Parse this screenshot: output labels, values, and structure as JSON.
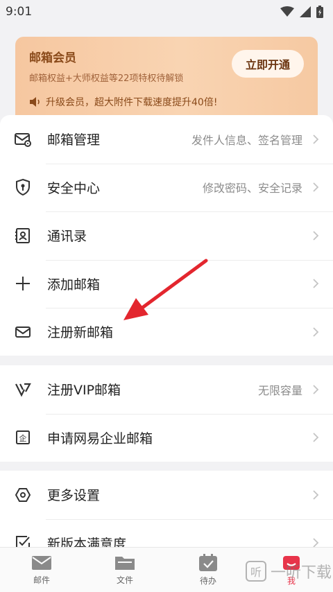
{
  "status_bar": {
    "time": "9:01"
  },
  "vip": {
    "title": "邮箱会员",
    "subtitle": "邮箱权益+大师权益等22项特权待解锁",
    "button": "立即开通",
    "promo": "升级会员，超大附件下载速度提升40倍!"
  },
  "menu": [
    {
      "label": "邮箱管理",
      "desc": "发件人信息、签名管理",
      "icon": "mail-settings-icon"
    },
    {
      "label": "安全中心",
      "desc": "修改密码、安全记录",
      "icon": "shield-icon"
    },
    {
      "label": "通讯录",
      "desc": "",
      "icon": "contacts-icon"
    },
    {
      "label": "添加邮箱",
      "desc": "",
      "icon": "plus-icon"
    },
    {
      "label": "注册新邮箱",
      "desc": "",
      "icon": "envelope-icon"
    }
  ],
  "menu2": [
    {
      "label": "注册VIP邮箱",
      "desc": "无限容量",
      "icon": "vip-icon"
    },
    {
      "label": "申请网易企业邮箱",
      "desc": "",
      "icon": "enterprise-icon"
    }
  ],
  "menu3": [
    {
      "label": "更多设置",
      "desc": "",
      "icon": "hexagon-settings-icon"
    },
    {
      "label": "新版本满意度",
      "desc": "",
      "icon": "checklist-icon"
    }
  ],
  "bottom_nav": [
    {
      "label": "邮件",
      "icon": "mail-icon"
    },
    {
      "label": "文件",
      "icon": "folder-icon"
    },
    {
      "label": "待办",
      "icon": "todo-icon"
    },
    {
      "label": "我",
      "icon": "profile-icon"
    }
  ],
  "watermark": {
    "glyph": "听",
    "text": "一听下载"
  },
  "colors": {
    "accent": "#e8344a",
    "vip_text": "#8a4a1a"
  }
}
